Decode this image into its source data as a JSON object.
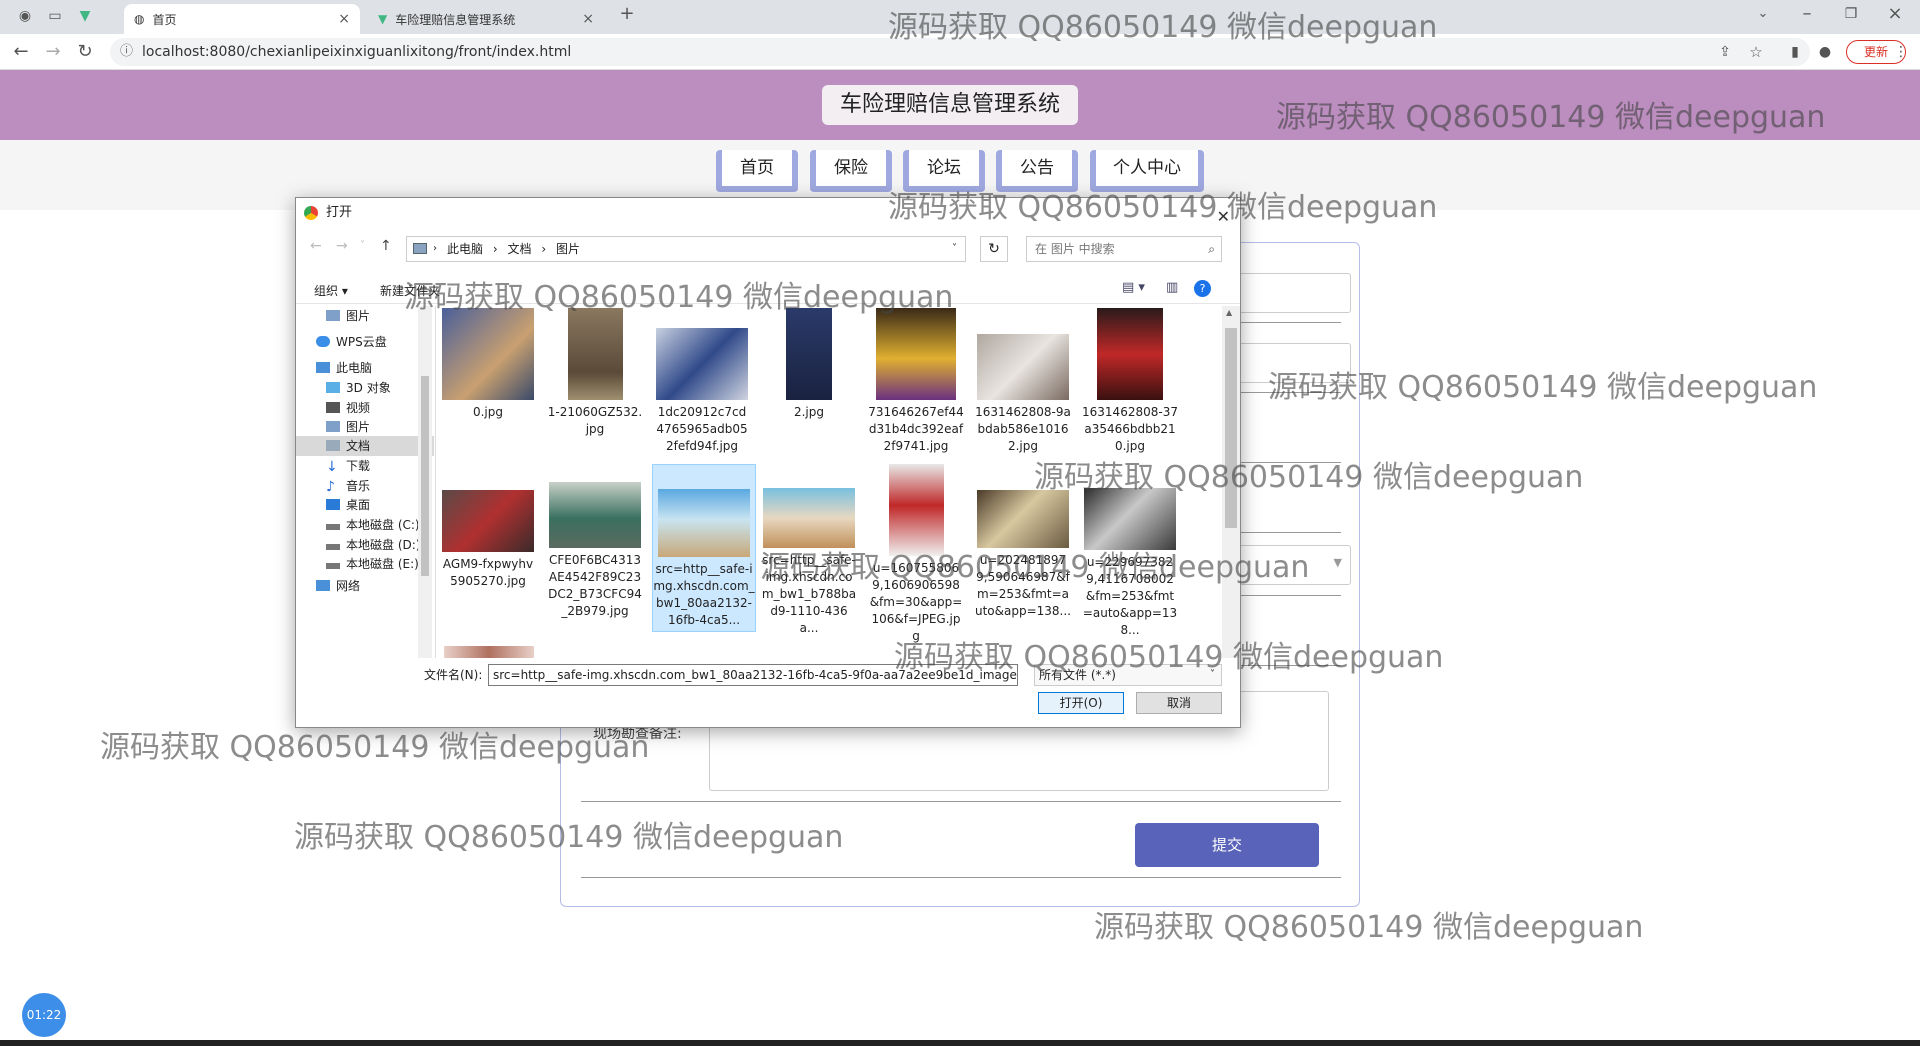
{
  "browser": {
    "tabs": [
      {
        "label": "首页",
        "active": true
      },
      {
        "label": "车险理赔信息管理系统",
        "active": false
      }
    ],
    "url": "localhost:8080/chexianlipeixinxiguanlixitong/front/index.html",
    "update_label": "更新"
  },
  "site": {
    "title": "车险理赔信息管理系统",
    "nav": [
      "首页",
      "保险",
      "论坛",
      "公告",
      "个人中心"
    ]
  },
  "form": {
    "remark_label": "现场勘查备注:",
    "submit_label": "提交"
  },
  "dialog": {
    "title": "打开",
    "path": [
      "此电脑",
      "文档",
      "图片"
    ],
    "search_placeholder": "在 图片 中搜索",
    "toolbar": {
      "organize": "组织 ▾",
      "new_folder": "新建文件夹"
    },
    "nav_items": [
      {
        "label": "图片",
        "icon": "pictures-icon"
      },
      {
        "label": "WPS云盘",
        "icon": "cloud-icon"
      },
      {
        "label": "此电脑",
        "icon": "computer-icon"
      },
      {
        "label": "3D 对象",
        "icon": "3d-objects-icon"
      },
      {
        "label": "视频",
        "icon": "video-icon"
      },
      {
        "label": "图片",
        "icon": "pictures-icon"
      },
      {
        "label": "文档",
        "icon": "documents-icon",
        "selected": true
      },
      {
        "label": "下载",
        "icon": "download-icon"
      },
      {
        "label": "音乐",
        "icon": "music-icon"
      },
      {
        "label": "桌面",
        "icon": "desktop-icon"
      },
      {
        "label": "本地磁盘 (C:)",
        "icon": "drive-icon"
      },
      {
        "label": "本地磁盘 (D:)",
        "icon": "drive-icon"
      },
      {
        "label": "本地磁盘 (E:)",
        "icon": "drive-icon"
      },
      {
        "label": "网络",
        "icon": "network-icon"
      }
    ],
    "files": [
      {
        "name": "0.jpg"
      },
      {
        "name": "1-21060GZ532.jpg"
      },
      {
        "name": "1dc20912c7cd4765965adb052fefd94f.jpg"
      },
      {
        "name": "2.jpg"
      },
      {
        "name": "731646267ef44d31b4dc392eaf2f9741.jpg"
      },
      {
        "name": "1631462808-9abdab586e10162.jpg"
      },
      {
        "name": "1631462808-37a35466bdbb210.jpg"
      },
      {
        "name": "AGM9-fxpwyhv5905270.jpg"
      },
      {
        "name": "CFE0F6BC4313AE4542F89C23DC2_B73CFC94_2B979.jpg"
      },
      {
        "name": "src=http__safe-img.xhscdn.com_bw1_80aa2132-16fb-4ca5...",
        "selected": true
      },
      {
        "name": "src=http__safe-img.xhscdn.com_bw1_b788bad9-1110-436a..."
      },
      {
        "name": "u=1607558069,1606906598&fm=30&app=106&f=JPEG.jpg"
      },
      {
        "name": "u=2024818979,590646987&fm=253&fmt=auto&app=138..."
      },
      {
        "name": "u=2296973829,4116708002&fm=253&fmt=auto&app=138..."
      }
    ],
    "filename_label": "文件名(N):",
    "filename_value": "src=http__safe-img.xhscdn.com_bw1_80aa2132-16fb-4ca5-9f0a-aa7a2ee9be1d_imageVi",
    "filetype": "所有文件 (*.*)",
    "open_label": "打开(O)",
    "cancel_label": "取消"
  },
  "timer": "01:22",
  "watermark": "源码获取 QQ86050149 微信deepguan"
}
